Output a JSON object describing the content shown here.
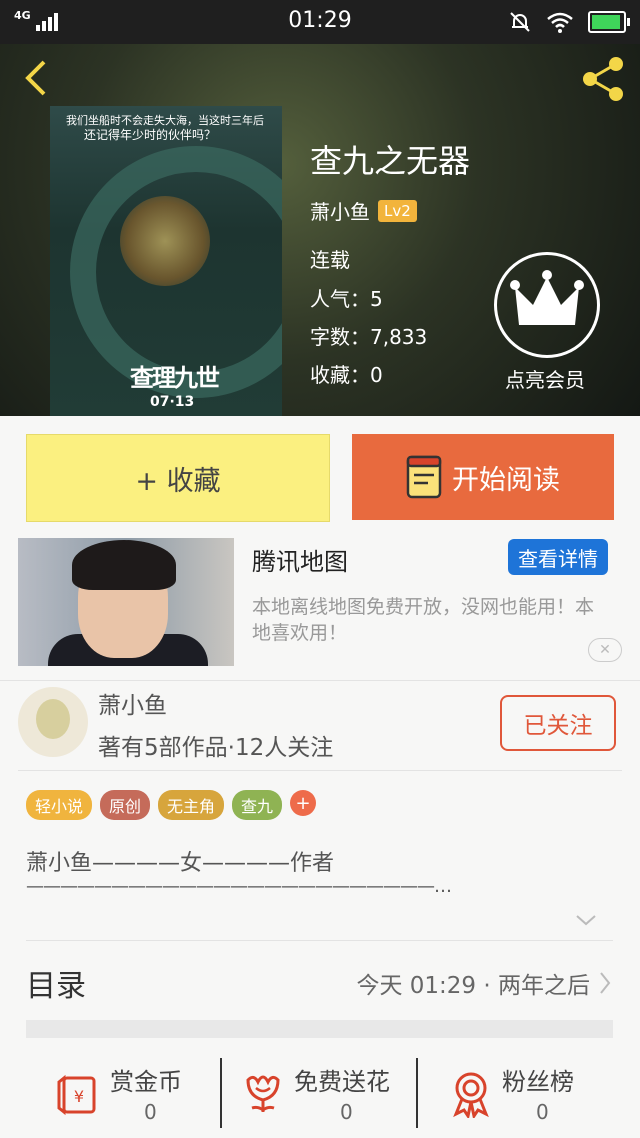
{
  "status_bar": {
    "time": "01:29",
    "network": "4G"
  },
  "book": {
    "title": "查九之无器",
    "author": "萧小鱼",
    "level": "Lv2",
    "status": "连载",
    "popularity": "人气：5",
    "word_count": "字数：7,833",
    "favorites": "收藏：0",
    "cover": {
      "tagline1": "我们坐船时不会走失大海，当这时三年后",
      "tagline2": "还记得年少时的伙伴吗？",
      "logo_text": "查理九世",
      "date": "07·13"
    }
  },
  "vip": {
    "label": "点亮会员"
  },
  "actions": {
    "collect": "+ 收藏",
    "read": "开始阅读"
  },
  "ad": {
    "title": "腾讯地图",
    "button": "查看详情",
    "description": "本地离线地图免费开放，没网也能用！本地喜欢用！"
  },
  "author_card": {
    "name": "萧小鱼",
    "info": "著有5部作品·12人关注",
    "follow_label": "已关注"
  },
  "tags": [
    {
      "label": "轻小说",
      "color": "#f0b43e"
    },
    {
      "label": "原创",
      "color": "#c56b5a"
    },
    {
      "label": "无主角",
      "color": "#d7a53c"
    },
    {
      "label": "查九",
      "color": "#8fb353"
    }
  ],
  "description": {
    "line1": "萧小鱼————女————作者",
    "line2": "————————————————————————…"
  },
  "toc": {
    "label": "目录",
    "latest": "今天 01:29 · 两年之后"
  },
  "bottom_bar": [
    {
      "label": "赏金币",
      "value": "0"
    },
    {
      "label": "免费送花",
      "value": "0"
    },
    {
      "label": "粉丝榜",
      "value": "0"
    }
  ],
  "colors": {
    "accent_orange": "#e86a3e",
    "collect_yellow": "#fbf080",
    "ad_blue": "#1e74d8",
    "icon_red": "#d8432b"
  }
}
